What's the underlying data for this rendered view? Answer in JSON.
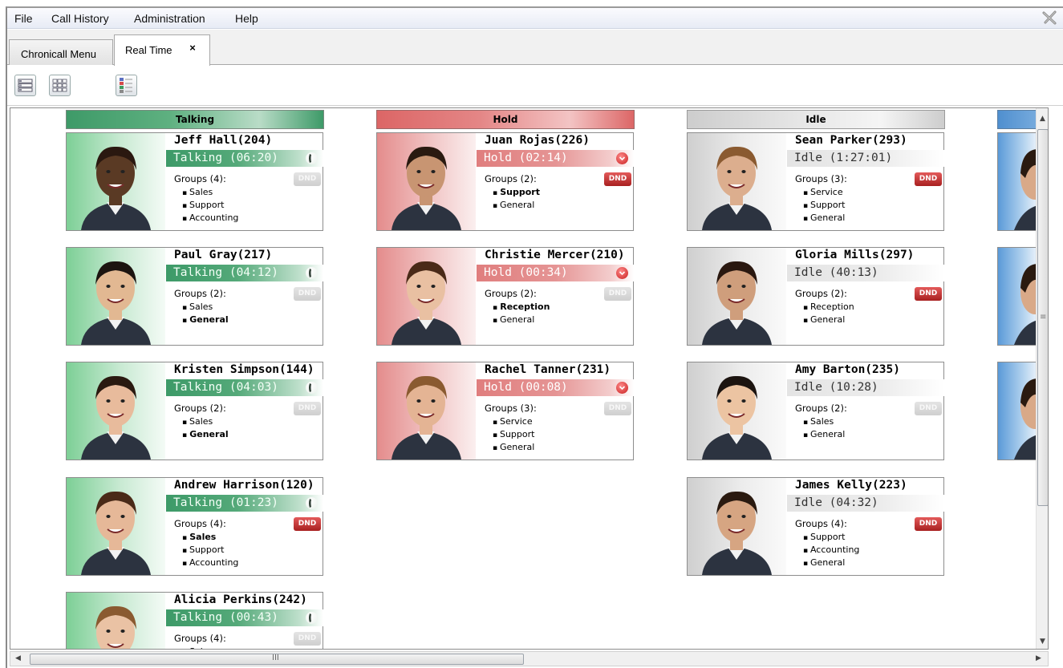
{
  "menu": {
    "items": [
      "File",
      "Call History",
      "Administration",
      "Help"
    ]
  },
  "tabs": {
    "menu_tab": "Chronicall Menu",
    "active_tab": "Real Time",
    "close_glyph": "×"
  },
  "toolbar": {
    "icons": [
      "list-view-icon",
      "grid-view-icon",
      "status-legend-icon"
    ]
  },
  "columns": [
    {
      "label": "Talking",
      "color": "#3f9a69"
    },
    {
      "label": "Hold",
      "color": "#d96565"
    },
    {
      "label": "Idle",
      "color": "#cfcfcf"
    },
    {
      "label": "",
      "color": "#4f8fcf"
    }
  ],
  "groups_word": "Groups",
  "dnd_label": "DND",
  "agents": {
    "talking": [
      {
        "name": "Jeff Hall(204)",
        "status": "Talking (06:20)",
        "groups_label": "Groups (4):",
        "groups": [
          "Sales",
          "Support",
          "Accounting"
        ],
        "bold": [],
        "dnd": false,
        "skin": "#5a3a24"
      },
      {
        "name": "Paul Gray(217)",
        "status": "Talking (04:12)",
        "groups_label": "Groups (2):",
        "groups": [
          "Sales",
          "General"
        ],
        "bold": [
          1
        ],
        "dnd": false,
        "skin": "#e2b892"
      },
      {
        "name": "Kristen Simpson(144)",
        "status": "Talking (04:03)",
        "groups_label": "Groups (2):",
        "groups": [
          "Sales",
          "General"
        ],
        "bold": [
          1
        ],
        "dnd": false,
        "skin": "#e8bb9c"
      },
      {
        "name": "Andrew Harrison(120)",
        "status": "Talking (01:23)",
        "groups_label": "Groups (4):",
        "groups": [
          "Sales",
          "Support",
          "Accounting"
        ],
        "bold": [
          0
        ],
        "dnd": true,
        "skin": "#e6b898"
      },
      {
        "name": "Alicia Perkins(242)",
        "status": "Talking (00:43)",
        "groups_label": "Groups (4):",
        "groups": [
          "Sales"
        ],
        "bold": [],
        "dnd": false,
        "skin": "#eac2a4"
      }
    ],
    "hold": [
      {
        "name": "Juan Rojas(226)",
        "status": "Hold (02:14)",
        "groups_label": "Groups (2):",
        "groups": [
          "Support",
          "General"
        ],
        "bold": [
          0
        ],
        "dnd": true,
        "skin": "#c89572"
      },
      {
        "name": "Christie Mercer(210)",
        "status": "Hold (00:34)",
        "groups_label": "Groups (2):",
        "groups": [
          "Reception",
          "General"
        ],
        "bold": [
          0
        ],
        "dnd": false,
        "skin": "#e9c0a2"
      },
      {
        "name": "Rachel Tanner(231)",
        "status": "Hold (00:08)",
        "groups_label": "Groups (3):",
        "groups": [
          "Service",
          "Support",
          "General"
        ],
        "bold": [],
        "dnd": false,
        "skin": "#e4b494"
      }
    ],
    "idle": [
      {
        "name": "Sean Parker(293)",
        "status": "Idle (1:27:01)",
        "groups_label": "Groups (3):",
        "groups": [
          "Service",
          "Support",
          "General"
        ],
        "bold": [],
        "dnd": true,
        "skin": "#dcae8e"
      },
      {
        "name": "Gloria Mills(297)",
        "status": "Idle (40:13)",
        "groups_label": "Groups (2):",
        "groups": [
          "Reception",
          "General"
        ],
        "bold": [],
        "dnd": true,
        "skin": "#cf9e7c"
      },
      {
        "name": "Amy Barton(235)",
        "status": "Idle (10:28)",
        "groups_label": "Groups (2):",
        "groups": [
          "Sales",
          "General"
        ],
        "bold": [],
        "dnd": false,
        "skin": "#ecc4a2"
      },
      {
        "name": "James Kelly(223)",
        "status": "Idle (04:32)",
        "groups_label": "Groups (4):",
        "groups": [
          "Support",
          "Accounting",
          "General"
        ],
        "bold": [],
        "dnd": true,
        "skin": "#d6a582"
      }
    ]
  },
  "scrollbar": {
    "h_grip": "III",
    "v_grip": "≡"
  }
}
